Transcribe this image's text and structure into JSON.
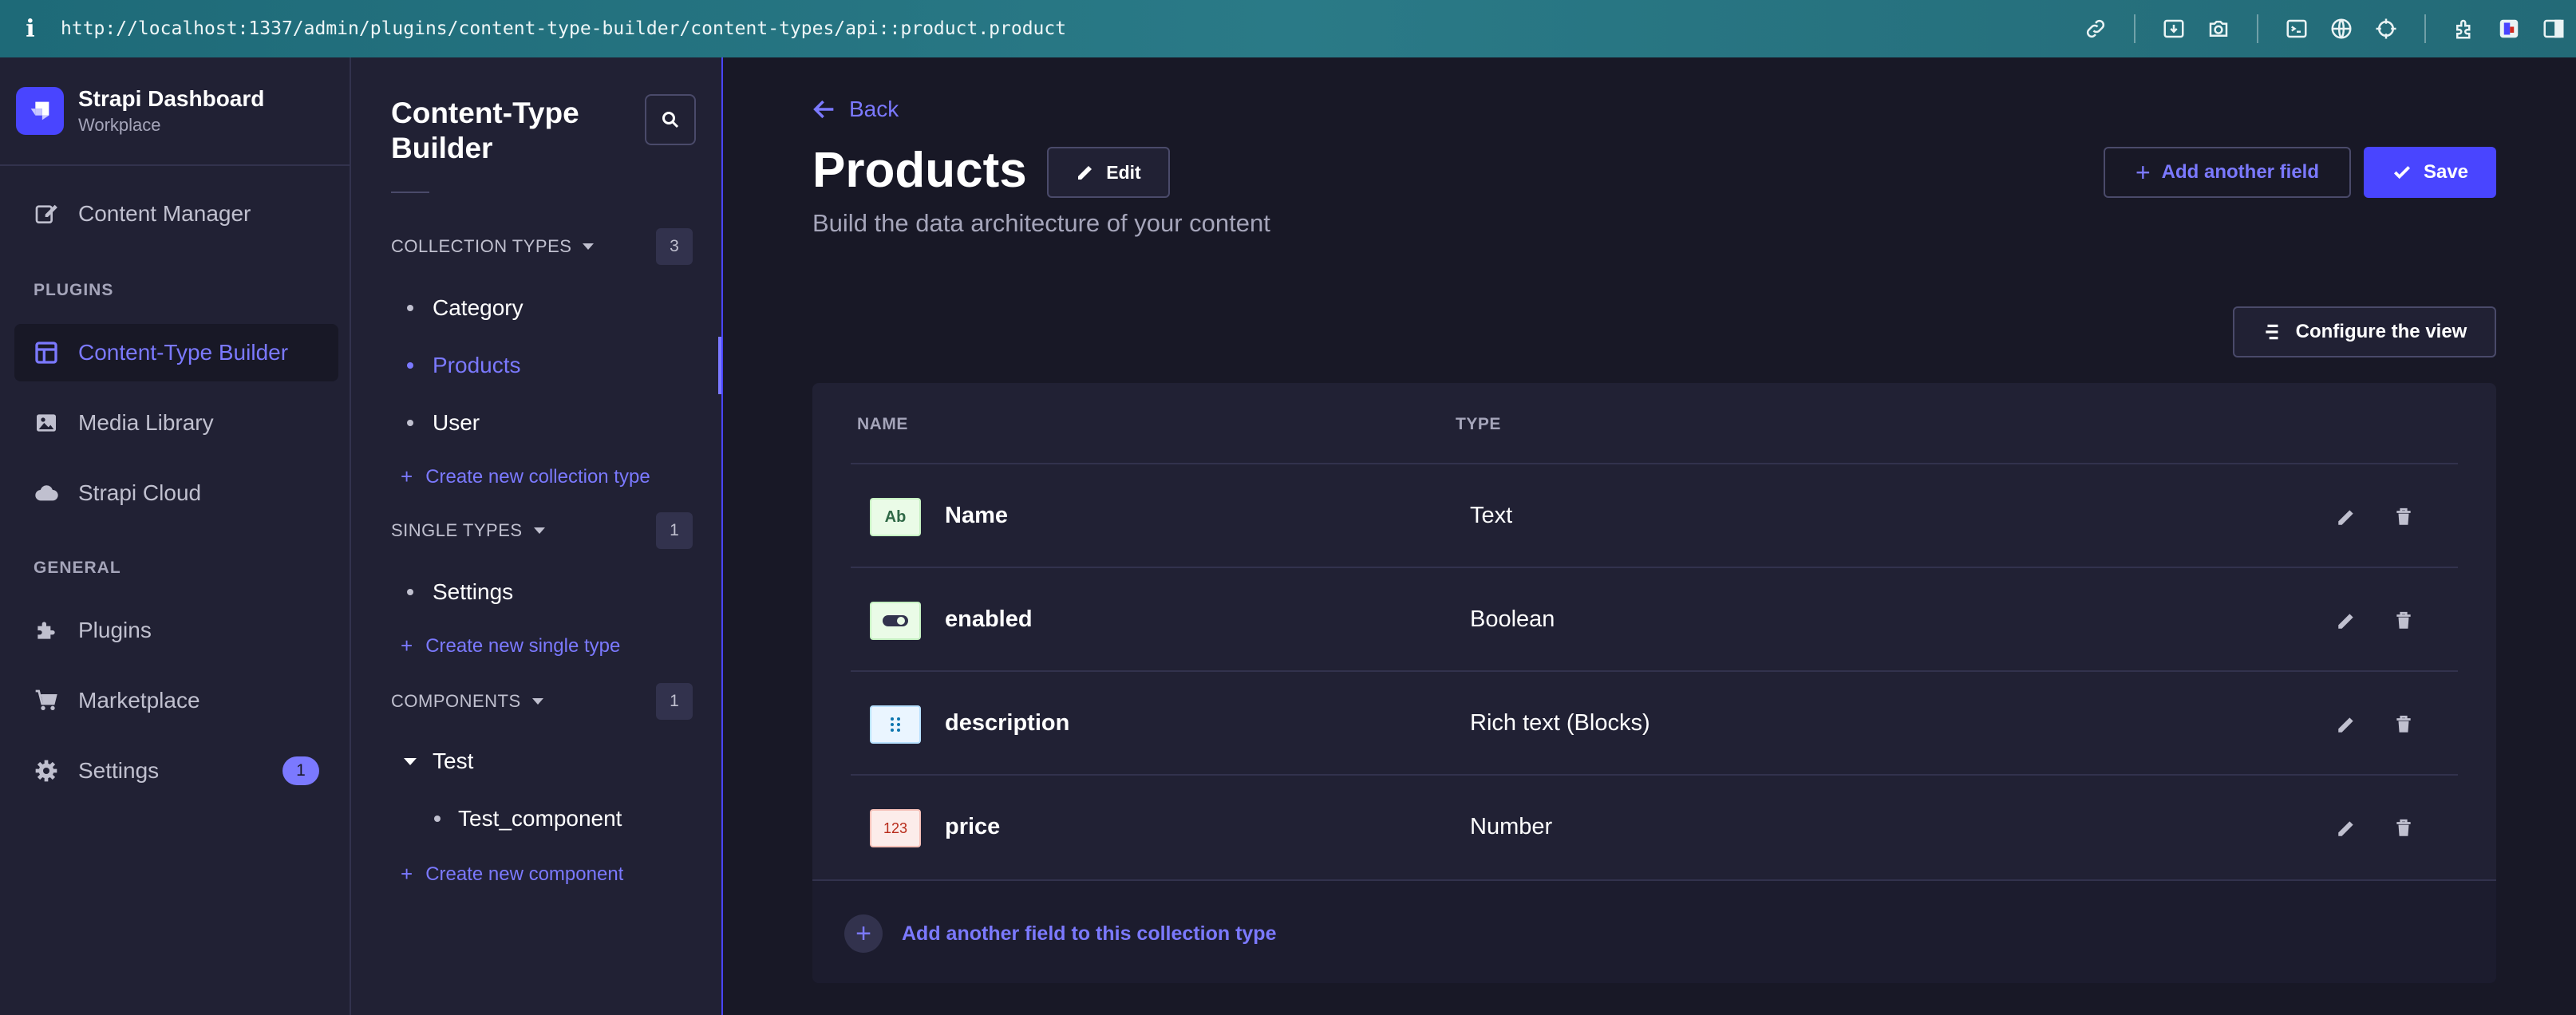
{
  "browser": {
    "url": "http://localhost:1337/admin/plugins/content-type-builder/content-types/api::product.product"
  },
  "brand": {
    "title": "Strapi Dashboard",
    "subtitle": "Workplace"
  },
  "main_nav": {
    "content_manager": "Content Manager",
    "plugins_section": "PLUGINS",
    "content_type_builder": "Content-Type Builder",
    "media_library": "Media Library",
    "strapi_cloud": "Strapi Cloud",
    "general_section": "GENERAL",
    "plugins": "Plugins",
    "marketplace": "Marketplace",
    "settings": "Settings",
    "settings_badge": "1"
  },
  "sub_nav": {
    "title_line1": "Content-Type",
    "title_line2": "Builder",
    "collection_types": {
      "label": "COLLECTION TYPES",
      "count": "3",
      "items": [
        "Category",
        "Products",
        "User"
      ],
      "create": "Create new collection type"
    },
    "single_types": {
      "label": "SINGLE TYPES",
      "count": "1",
      "items": [
        "Settings"
      ],
      "create": "Create new single type"
    },
    "components": {
      "label": "COMPONENTS",
      "count": "1",
      "group": "Test",
      "items": [
        "Test_component"
      ],
      "create": "Create new component"
    }
  },
  "header": {
    "back": "Back",
    "title": "Products",
    "edit": "Edit",
    "subtitle": "Build the data architecture of your content",
    "add_field": "Add another field",
    "save": "Save",
    "configure_view": "Configure the view"
  },
  "table": {
    "columns": [
      "NAME",
      "TYPE"
    ],
    "rows": [
      {
        "icon_label": "Ab",
        "icon": "text-type-icon",
        "name": "Name",
        "type": "Text"
      },
      {
        "icon_label": "",
        "icon": "boolean-type-icon",
        "name": "enabled",
        "type": "Boolean"
      },
      {
        "icon_label": "",
        "icon": "blocks-type-icon",
        "name": "description",
        "type": "Rich text (Blocks)"
      },
      {
        "icon_label": "123",
        "icon": "number-type-icon",
        "name": "price",
        "type": "Number"
      }
    ],
    "footer": "Add another field to this collection type"
  },
  "colors": {
    "primary": "#4945ff",
    "accent": "#7b79ff",
    "background": "#181826",
    "panel": "#212134"
  }
}
